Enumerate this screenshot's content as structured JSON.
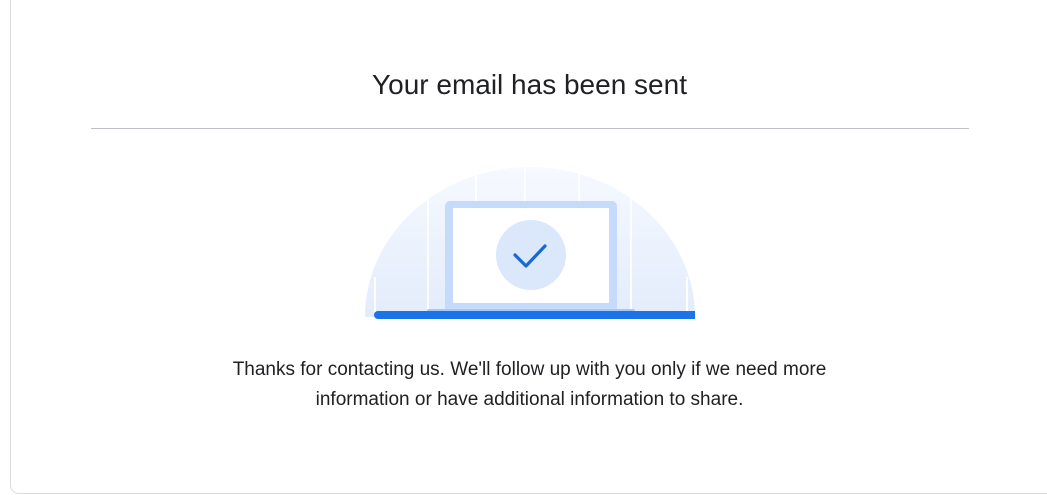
{
  "dialog": {
    "title": "Your email has been sent",
    "message_line1": "Thanks for contacting us. We'll follow up with you only if we need more",
    "message_line2": "information or have additional information to share."
  },
  "illustration": {
    "icon": "checkmark-icon",
    "colors": {
      "accent_blue": "#1a73e8",
      "check_blue": "#1967d2",
      "screen_frame": "#c6dafc",
      "circle_fill": "#dbe7fb",
      "dome_fill": "#eef3fd"
    }
  }
}
